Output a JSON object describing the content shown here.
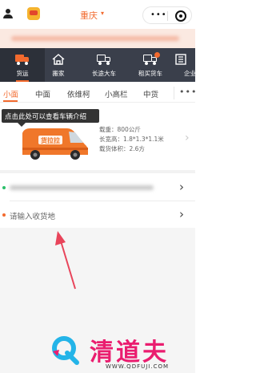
{
  "header": {
    "city": "重庆"
  },
  "services": [
    {
      "label": "货运",
      "icon": "freight-truck-icon",
      "active": true
    },
    {
      "label": "搬家",
      "icon": "moving-house-icon",
      "active": false
    },
    {
      "label": "长途大车",
      "icon": "long-haul-truck-icon",
      "active": false
    },
    {
      "label": "租买货车",
      "icon": "rent-buy-truck-icon",
      "active": false
    },
    {
      "label": "企业",
      "icon": "enterprise-icon",
      "active": false
    }
  ],
  "vehicle_tabs": [
    {
      "label": "小面",
      "active": true
    },
    {
      "label": "中面",
      "active": false
    },
    {
      "label": "依维柯",
      "active": false
    },
    {
      "label": "小高栏",
      "active": false
    },
    {
      "label": "中货",
      "active": false
    }
  ],
  "tooltip": {
    "text": "点击此处可以查看车辆介绍"
  },
  "vehicle": {
    "van_lettering": "货拉拉"
  },
  "specs": {
    "load": "载重：800公斤",
    "dims": "长宽高：1.8*1.3*1.1米",
    "volume": "载货体积：2.6方"
  },
  "address": {
    "destination_placeholder": "请输入收货地"
  },
  "watermark": {
    "text": "清道夫",
    "url": "WWW.QDFUJI.COM"
  },
  "colors": {
    "accent": "#f26a2e",
    "nav_bg": "#3a3f4b",
    "watermark": "#ea1d6f",
    "annotation_arrow": "#e8445a",
    "pickup_dot": "#2cbf6a",
    "destination_dot": "#f26a2e"
  }
}
